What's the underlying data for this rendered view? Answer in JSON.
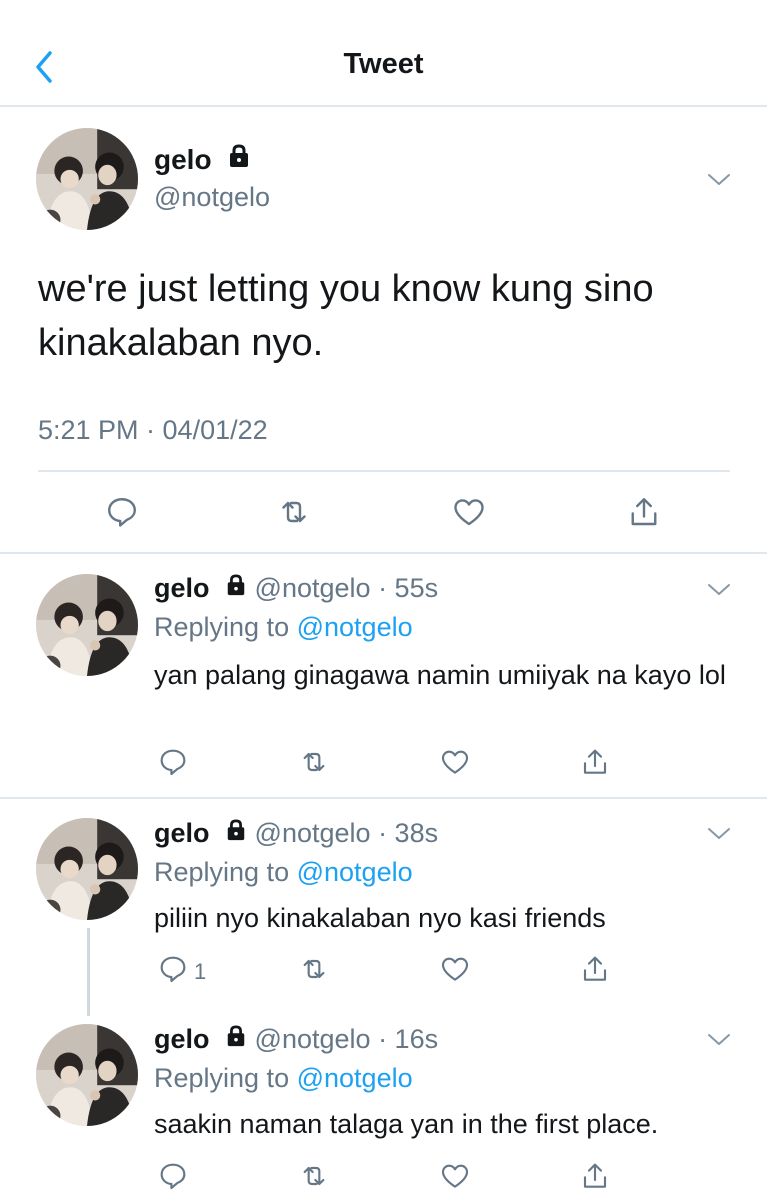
{
  "header": {
    "title": "Tweet"
  },
  "colors": {
    "accent": "#1da1f2",
    "secondary_text": "#657786",
    "divider": "#e1e8ed"
  },
  "main_tweet": {
    "name": "gelo",
    "handle": "@notgelo",
    "text": "we're just letting you know kung sino kinakalaban nyo.",
    "timestamp": "5:21 PM · 04/01/22"
  },
  "replies": [
    {
      "name": "gelo",
      "handle": "@notgelo",
      "time": "· 55s",
      "replying_label": "Replying to",
      "replying_handle": "@notgelo",
      "text": "yan palang ginagawa namin umiiyak na kayo lol",
      "reply_count": ""
    },
    {
      "name": "gelo",
      "handle": "@notgelo",
      "time": "· 38s",
      "replying_label": "Replying to",
      "replying_handle": "@notgelo",
      "text": "piliin nyo kinakalaban nyo kasi friends",
      "reply_count": "1"
    },
    {
      "name": "gelo",
      "handle": "@notgelo",
      "time": "· 16s",
      "replying_label": "Replying to",
      "replying_handle": "@notgelo",
      "text": "saakin naman talaga yan in the first place.",
      "reply_count": ""
    }
  ],
  "icons": [
    "back-chevron-icon",
    "lock-icon",
    "caret-down-icon",
    "reply-icon",
    "retweet-icon",
    "like-icon",
    "share-icon"
  ]
}
